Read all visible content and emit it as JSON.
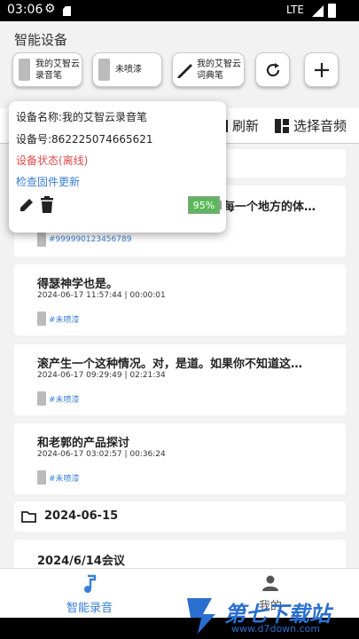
{
  "status": {
    "time": "03:06",
    "network": "LTE"
  },
  "section_title": "智能设备",
  "devices": [
    {
      "label": "我的艾智云录音笔"
    },
    {
      "label": "未喷漆"
    },
    {
      "label": "我的艾智云词典笔"
    }
  ],
  "toolbar": {
    "refresh_label": "刷新",
    "select_audio_label": "选择音频"
  },
  "popup": {
    "device_name": "设备名称:我的艾智云录音笔",
    "device_id": "设备号:862225074665621",
    "device_status": "设备状态(离线)",
    "firmware_check": "检查固件更新",
    "battery": "95%",
    "battery_level": 0.95
  },
  "cards": [
    {
      "title": "每一个地方的体…",
      "tag": "#999990123456789"
    },
    {
      "title": "得瑟神学也是。",
      "meta": "2024-06-17 11:57:44 | 00:00:01",
      "tag": "#未喷漆"
    },
    {
      "title": "滚产生一个这种情况。对，是道。如果你不知道这…",
      "meta": "2024-06-17 09:29:49 | 02:21:34",
      "tag": "#未喷漆"
    },
    {
      "title": "和老郭的产品探讨",
      "meta": "2024-06-17 03:02:57 | 00:36:24",
      "tag": "#未喷漆"
    },
    {
      "title": "2024/6/14会议"
    }
  ],
  "date_group": "2024-06-15",
  "tabs": {
    "record": "智能录音",
    "mine": "我的"
  },
  "colors": {
    "accent": "#3a7fd5",
    "offline": "#e04a4a",
    "battery": "#5cb85c"
  },
  "watermark": {
    "text": "第七下载站",
    "url": "www.d7down.com"
  }
}
